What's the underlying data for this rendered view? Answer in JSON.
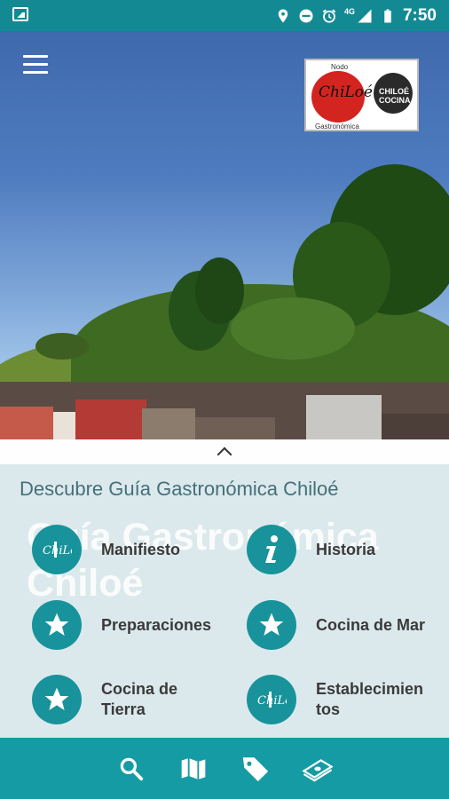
{
  "status_bar": {
    "time": "7:50",
    "network": "4G",
    "icons": [
      "image-icon",
      "location-icon",
      "do-not-disturb-icon",
      "alarm-icon",
      "signal-icon",
      "battery-icon"
    ]
  },
  "header": {
    "menu_icon": "hamburger-menu-icon",
    "logo": {
      "top_text": "Nodo",
      "main_text": "ChiLoé",
      "bottom_text": "Gastronómica",
      "secondary_text": "CHILOÉ COCINA"
    }
  },
  "sheet": {
    "title": "Descubre Guía Gastronómica Chiloé",
    "background_title_line1": "Guía Gastronómica",
    "background_title_line2": "Chiloé",
    "items": [
      {
        "label": "Manifiesto",
        "icon": "chiloe-logo-icon"
      },
      {
        "label": "Historia",
        "icon": "info-icon"
      },
      {
        "label": "Preparaciones",
        "icon": "star-icon"
      },
      {
        "label": "Cocina de Mar",
        "icon": "star-icon"
      },
      {
        "label": "Cocina de\nTierra",
        "icon": "star-icon"
      },
      {
        "label": "Establecimien\ntos",
        "icon": "chiloe-logo-icon"
      }
    ]
  },
  "bottom_nav": {
    "items": [
      "search-icon",
      "map-icon",
      "tag-icon",
      "money-icon"
    ]
  },
  "colors": {
    "primary": "#18939b",
    "status_bar": "#138a93",
    "nav_bar": "#159ba4",
    "sheet_title": "#44707a"
  }
}
